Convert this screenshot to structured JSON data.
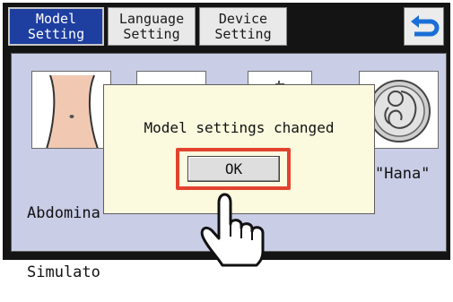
{
  "tabs": [
    {
      "line1": "Model",
      "line2": "Setting",
      "active": true
    },
    {
      "line1": "Language",
      "line2": "Setting",
      "active": false
    },
    {
      "line1": "Device",
      "line2": "Setting",
      "active": false
    }
  ],
  "back_button": {
    "icon": "back-arrow-icon"
  },
  "models": [
    {
      "label_line1": "Abdomina",
      "label_line2": "Simulato",
      "icon": "abdomen-icon"
    },
    {
      "label": "\"Hana\"",
      "icon": "fetus-icon"
    }
  ],
  "dialog": {
    "message": "Model settings changed",
    "ok_label": "OK"
  },
  "colors": {
    "active_tab": "#1e3ea0",
    "panel": "#c9cde6",
    "dialog": "#fbf9de",
    "highlight": "#e2432e",
    "back_arrow": "#1a6fd6"
  }
}
